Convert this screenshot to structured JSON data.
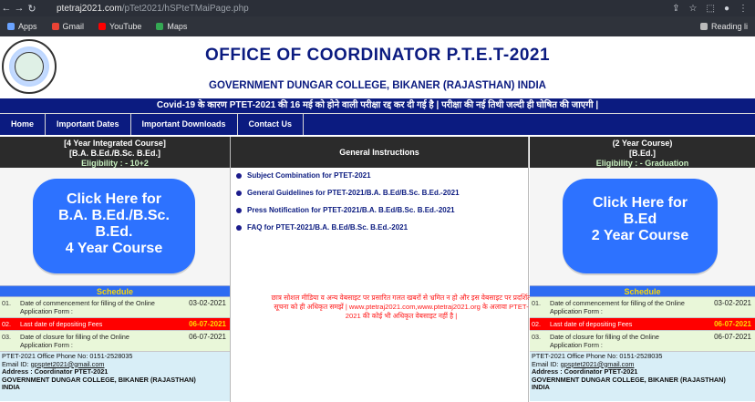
{
  "browser": {
    "url_main": "ptetraj2021.com",
    "url_path": "/pTet2021/hSPteTMaiPage.php",
    "bookmarks": [
      "Apps",
      "Gmail",
      "YouTube",
      "Maps"
    ],
    "reading_list": "Reading li"
  },
  "site": {
    "title": "OFFICE OF COORDINATOR P.T.E.T-2021",
    "subtitle": "GOVERNMENT DUNGAR COLLEGE, BIKANER (RAJASTHAN) INDIA",
    "notice": "Covid-19 के कारण PTET-2021 की 16 मई को होने वाली परीक्षा रद्द कर दी गई है | परीक्षा की नई तिथी जल्दी ही घोषित की जाएगी |"
  },
  "menu": [
    "Home",
    "Important Dates",
    "Important Downloads",
    "Contact Us"
  ],
  "left": {
    "head_line1": "[4 Year Integrated Course]",
    "head_line2": "[B.A. B.Ed./B.Sc. B.Ed.]",
    "eligibility": "Eligibility : - 10+2",
    "banner_line1": "Click Here for",
    "banner_line2": "B.A. B.Ed./B.Sc.",
    "banner_line3": "B.Ed.",
    "banner_line4": "4 Year Course",
    "schedule_title": "Schedule",
    "schedule": [
      {
        "no": "01.",
        "desc": "Date of commencement for filling of the Online Application Form :",
        "date": "03-02-2021"
      },
      {
        "no": "02.",
        "desc": "Last date of depositing Fees",
        "date": "06-07-2021"
      },
      {
        "no": "03.",
        "desc": "Date of closure for filling of the Online Application Form :",
        "date": "06-07-2021"
      }
    ],
    "info_phone": "PTET-2021 Office Phone No: 0151-2528035",
    "info_email_label": "Email ID:",
    "info_email": "gpsptet2021@gmail.com",
    "info_address_label": "Address : Coordinator PTET-2021",
    "info_college": "GOVERNMENT DUNGAR COLLEGE, BIKANER (RAJASTHAN)",
    "info_country": "INDIA"
  },
  "middle": {
    "head": "General Instructions",
    "links": [
      "Subject Combination for PTET-2021",
      "General Guidelines for PTET-2021/B.A. B.Ed/B.Sc. B.Ed.-2021",
      "Press Notification for PTET-2021/B.A. B.Ed/B.Sc. B.Ed.-2021",
      "FAQ for PTET-2021/B.A. B.Ed/B.Sc. B.Ed.-2021"
    ],
    "note": "छात्र सोशल मीडिया व अन्य वेबसाइट पर प्रसारित गलत खबरों से भ्रमित न हो और इस वेबसाइट पर प्रदर्शित सूचना को ही अधिकृत समझें | www.ptetraj2021.com,www.ptetraj2021.org के अलावा PTET-2021 की कोई भी अधिकृत वेबसाइट नहीं है |"
  },
  "right": {
    "head_line1": "(2 Year Course)",
    "head_line2": "[B.Ed.]",
    "eligibility": "Eligibility : - Graduation",
    "banner_line1": "Click Here for",
    "banner_line2": "B.Ed",
    "banner_line3": "2 Year Course",
    "schedule_title": "Schedule",
    "schedule": [
      {
        "no": "01.",
        "desc": "Date of commencement for filling of the Online Application Form :",
        "date": "03-02-2021"
      },
      {
        "no": "02.",
        "desc": "Last date of depositing Fees",
        "date": "06-07-2021"
      },
      {
        "no": "03.",
        "desc": "Date of closure for filling of the Online Application Form :",
        "date": "06-07-2021"
      }
    ],
    "info_phone": "PTET-2021 Office Phone No: 0151-2528035",
    "info_email_label": "Email ID:",
    "info_email": "gpsptet2021@gmail.com",
    "info_address_label": "Address : Coordinator PTET-2021",
    "info_college": "GOVERNMENT DUNGAR COLLEGE, BIKANER (RAJASTHAN)",
    "info_country": "INDIA"
  }
}
